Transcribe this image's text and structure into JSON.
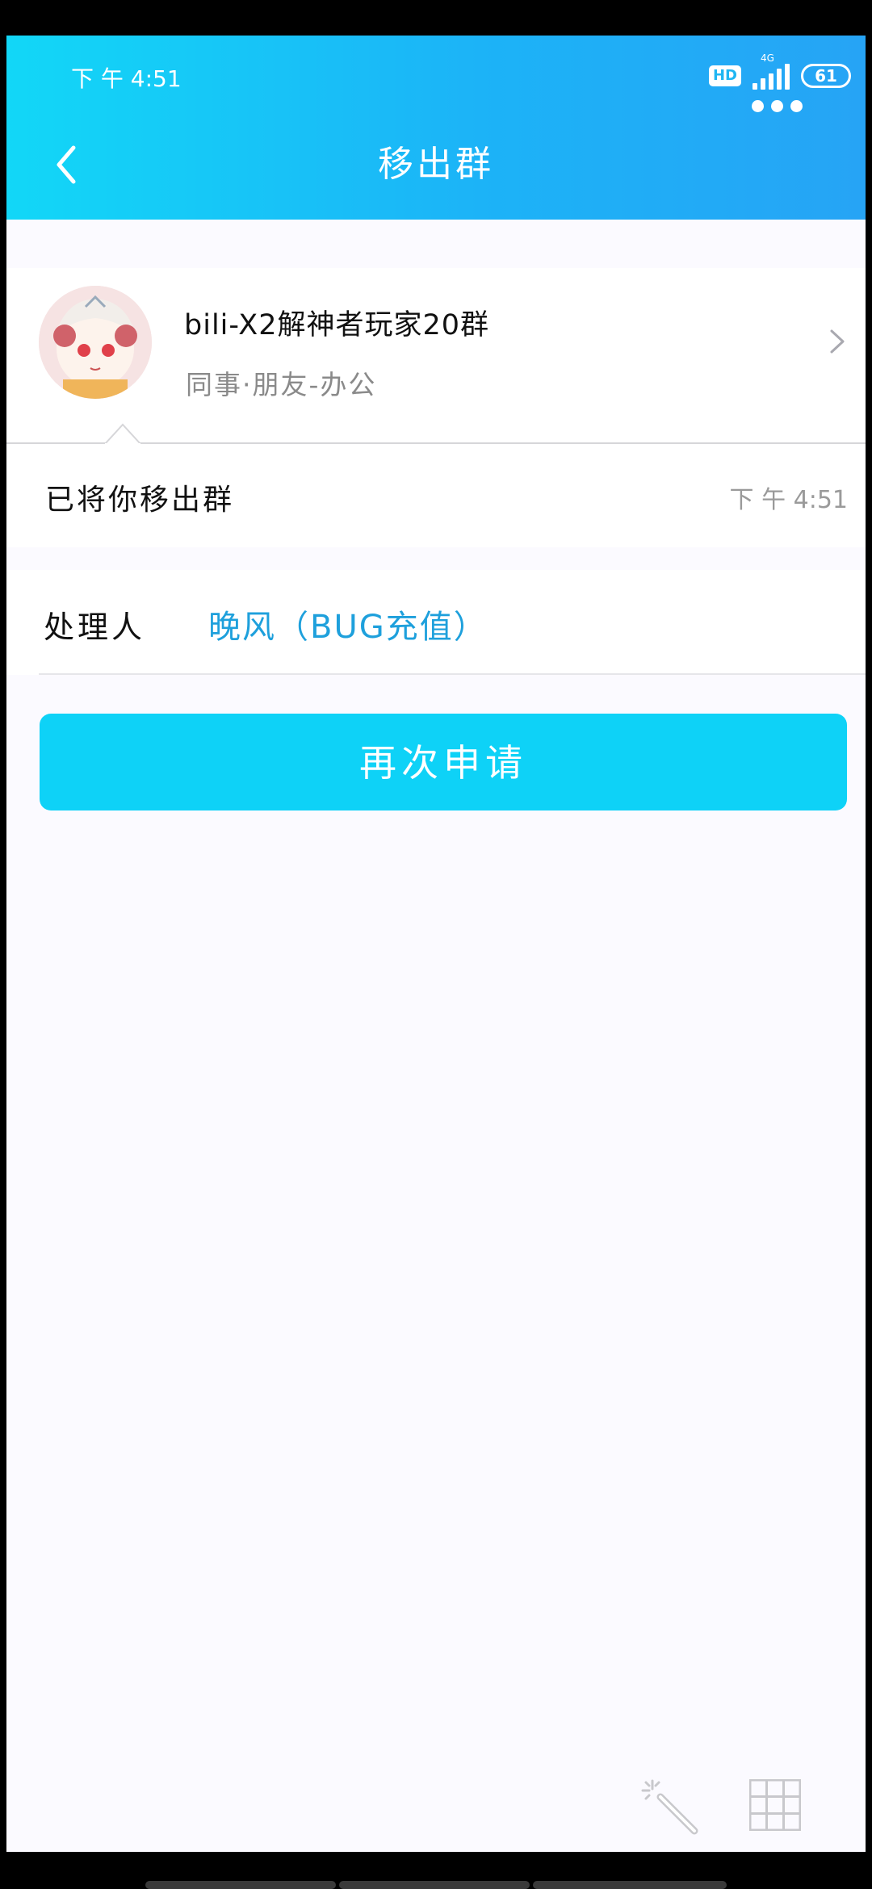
{
  "status_bar": {
    "time": "下 午 4:51",
    "hd_label": "HD",
    "network_label": "4G",
    "battery": "61"
  },
  "header": {
    "title": "移出群"
  },
  "group": {
    "name": "bili-X2解神者玩家20群",
    "category": "同事·朋友-办公"
  },
  "message": {
    "text": "已将你移出群",
    "time": "下 午 4:51"
  },
  "handler": {
    "label": "处理人",
    "name": "晚风（BUG充值）"
  },
  "actions": {
    "reapply_label": "再次申请"
  },
  "colors": {
    "accent": "#0ed2f7",
    "link": "#1ea0dc",
    "header_gradient_start": "#12d7f7",
    "header_gradient_end": "#26a4f5"
  },
  "icons": {
    "back": "chevron-left-icon",
    "forward": "chevron-right-icon",
    "more": "more-dots-icon",
    "wand": "magic-wand-icon",
    "grid": "grid-icon"
  }
}
